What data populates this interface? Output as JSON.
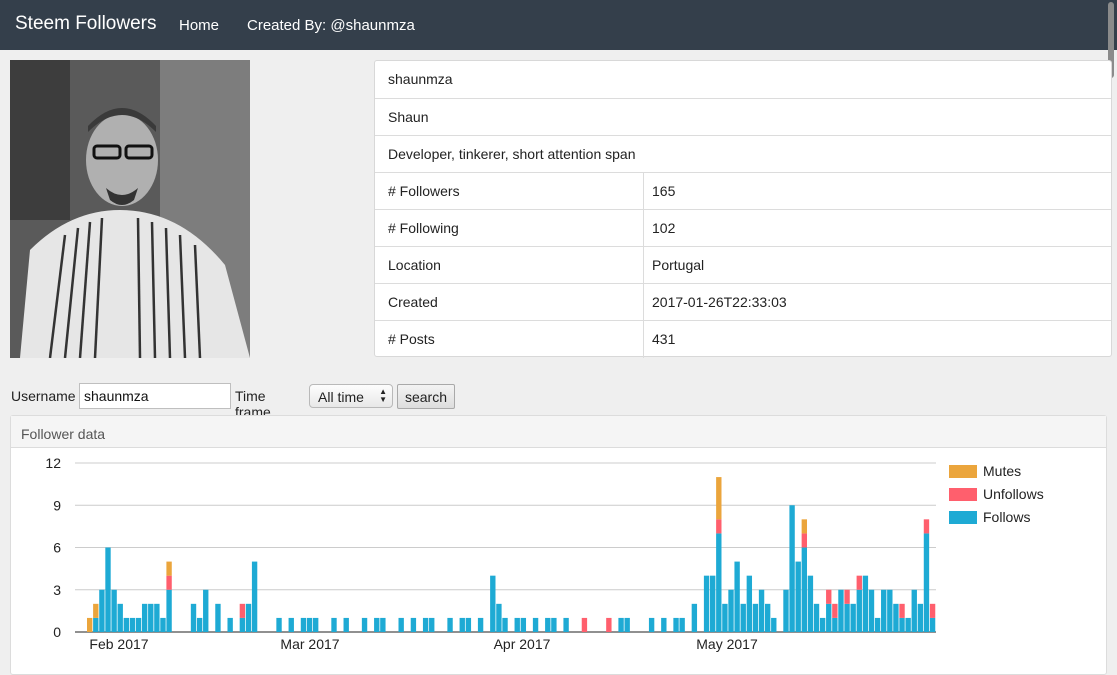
{
  "navbar": {
    "brand": "Steem Followers",
    "links": [
      "Home",
      "Created By: @shaunmza"
    ]
  },
  "profile": {
    "username": "shaunmza",
    "name": "Shaun",
    "about": "Developer, tinkerer, short attention span",
    "rows": [
      {
        "label": "# Followers",
        "value": "165"
      },
      {
        "label": "# Following",
        "value": "102"
      },
      {
        "label": "Location",
        "value": "Portugal"
      },
      {
        "label": "Created",
        "value": "2017-01-26T22:33:03"
      },
      {
        "label": "# Posts",
        "value": "431"
      }
    ]
  },
  "search_form": {
    "username_label": "Username",
    "username_value": "shaunmza",
    "timeframe_label": "Time frame",
    "timeframe_value": "All time",
    "search_button": "search"
  },
  "panel": {
    "heading": "Follower data"
  },
  "chart_data": {
    "type": "bar",
    "stacked": true,
    "ylim": [
      0,
      12
    ],
    "yticks": [
      0,
      3,
      6,
      9,
      12
    ],
    "grid": true,
    "legend_position": "right",
    "xtick_labels": [
      "Feb 2017",
      "Mar 2017",
      "Apr 2017",
      "May 2017"
    ],
    "colors": {
      "Follows": "#1eaad4",
      "Unfollows": "#ff5f6d",
      "Mutes": "#eba53c"
    },
    "series": [
      {
        "name": "Mutes",
        "color": "#eba53c",
        "values": [
          1,
          1,
          0,
          0,
          0,
          0,
          0,
          0,
          0,
          0,
          0,
          0,
          0,
          1,
          0,
          0,
          0,
          0,
          0,
          0,
          0,
          0,
          0,
          0,
          0,
          0,
          0,
          0,
          0,
          0,
          0,
          0,
          0,
          0,
          0,
          0,
          0,
          0,
          0,
          0,
          0,
          0,
          0,
          0,
          0,
          0,
          0,
          0,
          0,
          0,
          0,
          0,
          0,
          0,
          0,
          0,
          0,
          0,
          0,
          0,
          0,
          0,
          0,
          0,
          0,
          0,
          0,
          0,
          0,
          0,
          0,
          0,
          0,
          0,
          0,
          0,
          0,
          0,
          0,
          0,
          0,
          0,
          0,
          0,
          0,
          0,
          0,
          0,
          0,
          0,
          0,
          0,
          0,
          0,
          0,
          0,
          0,
          0,
          0,
          0,
          0,
          0,
          0,
          0,
          0,
          0,
          0,
          0,
          0,
          0,
          0,
          0,
          0,
          0,
          0,
          0,
          0,
          0,
          0,
          0,
          0,
          0,
          0,
          0,
          0,
          0,
          0,
          0,
          0,
          0,
          0,
          0,
          0,
          0,
          0,
          0,
          0,
          0,
          0,
          0,
          0,
          0,
          0,
          0,
          0,
          0,
          0,
          0,
          0,
          0,
          0,
          0,
          0,
          0,
          0,
          0,
          0,
          0,
          0,
          0,
          0,
          0,
          0,
          0,
          0,
          0,
          0,
          0,
          0,
          0,
          0,
          0,
          0,
          0,
          0,
          0,
          3,
          0,
          0,
          0,
          0,
          0,
          0,
          0,
          0,
          0,
          0,
          0,
          0,
          0,
          0,
          0,
          0,
          0,
          0,
          0,
          1,
          0,
          0,
          0,
          0,
          0,
          0,
          0,
          0,
          0,
          0,
          0,
          0,
          0,
          0,
          0,
          0,
          0,
          0,
          0,
          0,
          0,
          0,
          0,
          0,
          0,
          0
        ]
      },
      {
        "name": "Unfollows",
        "color": "#ff5f6d",
        "values": [
          0,
          0,
          0,
          0,
          0,
          0,
          0,
          0,
          0,
          0,
          0,
          0,
          0,
          1,
          0,
          0,
          0,
          0,
          0,
          0,
          0,
          0,
          0,
          1,
          0,
          0,
          0,
          0,
          0,
          0,
          0,
          0,
          0,
          0,
          0,
          0,
          0,
          0,
          0,
          0,
          0,
          0,
          0,
          0,
          0,
          0,
          0,
          0,
          0,
          0,
          0,
          0,
          0,
          0,
          0,
          0,
          0,
          0,
          0,
          0,
          0,
          0,
          0,
          0,
          0,
          0,
          0,
          0,
          0,
          0,
          0,
          0,
          0,
          0,
          0,
          0,
          0,
          0,
          0,
          0,
          0,
          0,
          0,
          0,
          0,
          0,
          0,
          0,
          0,
          0,
          0,
          0,
          0,
          0,
          0,
          0,
          0,
          0,
          0,
          0,
          0,
          0,
          0,
          0,
          0,
          0,
          0,
          0,
          0,
          0,
          0,
          0,
          0,
          0,
          0,
          0,
          0,
          0,
          0,
          0,
          0,
          0,
          0,
          0,
          0,
          0,
          0,
          0,
          0,
          0,
          0,
          0,
          0,
          0,
          0,
          0,
          0,
          0,
          0,
          0,
          0,
          0,
          0,
          0,
          0,
          0,
          0,
          0,
          0,
          0,
          0,
          0,
          0,
          0,
          0,
          0,
          0,
          0,
          0,
          0,
          0,
          0,
          0,
          0,
          0,
          0,
          0,
          0,
          0,
          0,
          0,
          0,
          0,
          0,
          0,
          0,
          1,
          0,
          0,
          0,
          0,
          0,
          0,
          0,
          0,
          0,
          0,
          0,
          0,
          0,
          0,
          0,
          0,
          0,
          0,
          0,
          1,
          0,
          0,
          0,
          0,
          0,
          0,
          0,
          0,
          0,
          0,
          0,
          0,
          0,
          0,
          0,
          0,
          0,
          0,
          0,
          0,
          0,
          0,
          0,
          0,
          0,
          0
        ]
      }
    ]
  }
}
